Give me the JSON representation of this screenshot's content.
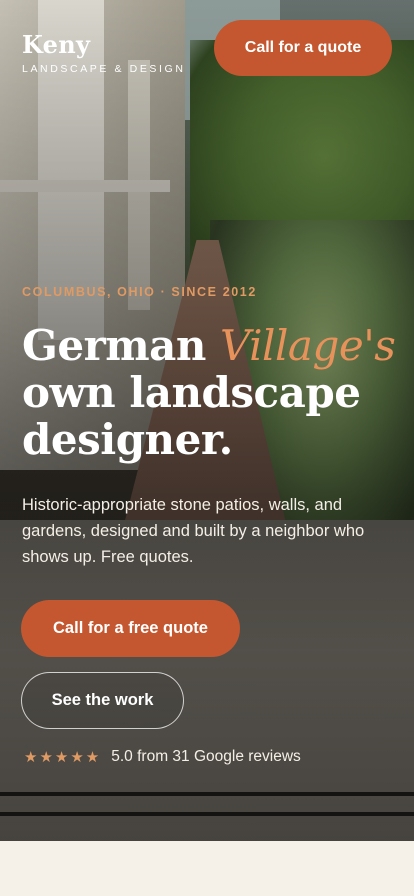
{
  "brand": {
    "name": "Keny",
    "tagline": "LANDSCAPE & DESIGN"
  },
  "header": {
    "cta_label": "Call for a quote"
  },
  "hero": {
    "eyebrow": "COLUMBUS, OHIO · SINCE 2012",
    "headline_part1": "German ",
    "headline_accent": "Village's",
    "headline_part2": "own landscape designer.",
    "subcopy": "Historic-appropriate stone patios, walls, and gardens, designed and built by a neighbor who shows up. Free quotes.",
    "primary_cta": "Call for a free quote",
    "secondary_cta": "See the work",
    "stars": "★★★★★",
    "reviews_text": "5.0 from 31 Google reviews"
  },
  "colors": {
    "accent": "#c4572f",
    "eyebrow": "#e09a64",
    "page_bg": "#f5f1e8"
  }
}
